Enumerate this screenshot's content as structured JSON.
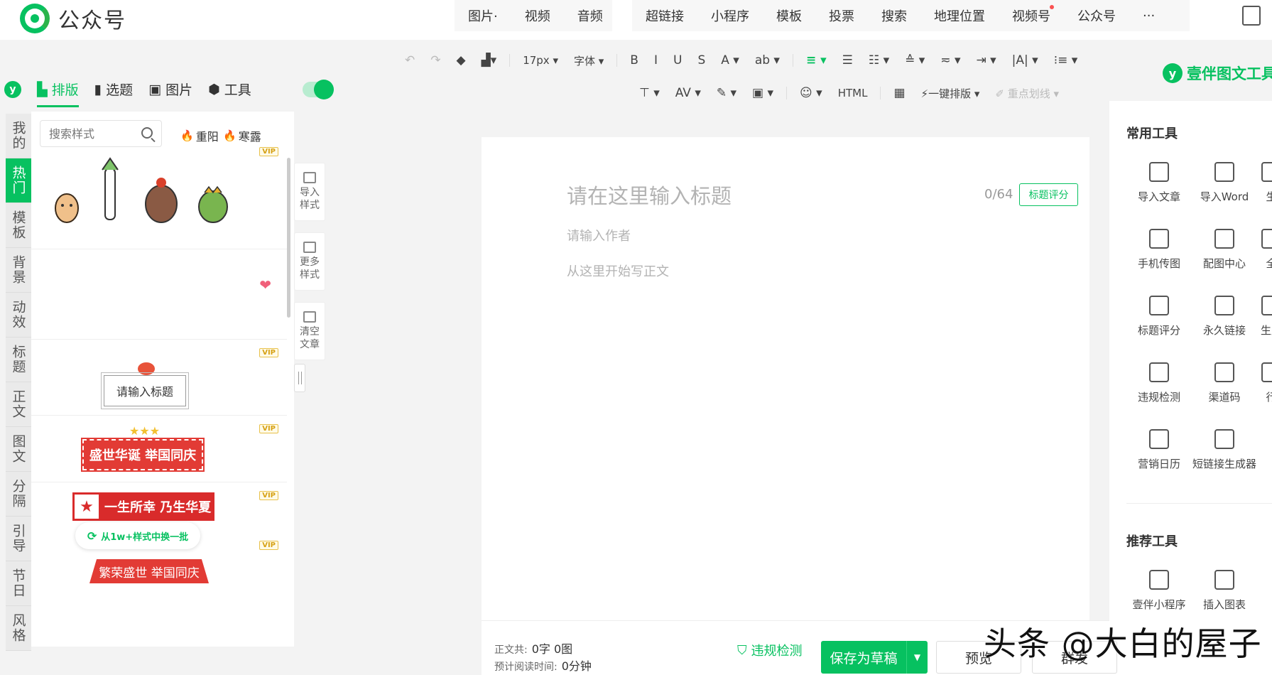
{
  "brand": {
    "name": "公众号"
  },
  "insert_group_1": [
    {
      "label": "图片·",
      "dot": false
    },
    {
      "label": "视频",
      "dot": false
    },
    {
      "label": "音频",
      "dot": false
    }
  ],
  "insert_group_2": [
    {
      "label": "超链接",
      "dot": false
    },
    {
      "label": "小程序",
      "dot": false
    },
    {
      "label": "模板",
      "dot": false
    },
    {
      "label": "投票",
      "dot": false
    },
    {
      "label": "搜索",
      "dot": false
    },
    {
      "label": "地理位置",
      "dot": false
    },
    {
      "label": "视频号",
      "dot": true
    },
    {
      "label": "公众号",
      "dot": false
    },
    {
      "label": "···",
      "dot": false
    }
  ],
  "toolbar_row1": [
    {
      "label": "↶",
      "name": "undo-icon",
      "dim": true
    },
    {
      "label": "↷",
      "name": "redo-icon",
      "dim": true
    },
    {
      "label": "◆",
      "name": "eraser-icon"
    },
    {
      "label": "▟▾",
      "name": "format-painter-icon"
    },
    {
      "label": "17px ▾",
      "name": "font-size-select",
      "sm": true
    },
    {
      "label": "字体 ▾",
      "name": "font-family-select",
      "sm": true
    },
    {
      "label": "B",
      "name": "bold-icon"
    },
    {
      "label": "I",
      "name": "italic-icon"
    },
    {
      "label": "U",
      "name": "underline-icon"
    },
    {
      "label": "S",
      "name": "strikethrough-icon"
    },
    {
      "label": "A ▾",
      "name": "font-color-icon"
    },
    {
      "label": "ab ▾",
      "name": "highlight-icon"
    },
    {
      "label": "≡ ▾",
      "name": "align-icon",
      "active": true
    },
    {
      "label": "☰",
      "name": "indent-icon"
    },
    {
      "label": "☷ ▾",
      "name": "line-height-icon"
    },
    {
      "label": "≙ ▾",
      "name": "paragraph-spacing-icon"
    },
    {
      "label": "≂ ▾",
      "name": "spacing-after-icon"
    },
    {
      "label": "⇥ ▾",
      "name": "indent-list-icon"
    },
    {
      "label": "|A| ▾",
      "name": "letter-spacing-icon"
    },
    {
      "label": "⁝≡ ▾",
      "name": "list-icon"
    }
  ],
  "toolbar_row2": [
    {
      "label": "⊤ ▾",
      "name": "divider-icon"
    },
    {
      "label": "AV ▾",
      "name": "kerning-icon"
    },
    {
      "label": "✎ ▾",
      "name": "magic-pen-icon"
    },
    {
      "label": "▣ ▾",
      "name": "image-icon"
    },
    {
      "label": "☺ ▾",
      "name": "emoji-icon"
    },
    {
      "label": "HTML",
      "name": "html-icon",
      "sm": true
    },
    {
      "label": "▦",
      "name": "toolbox-icon"
    },
    {
      "label": "⚡一键排版 ▾",
      "name": "one-click-layout-button",
      "sm": true
    },
    {
      "label": "✐ 重点划线 ▾",
      "name": "key-underline-button",
      "sm": true,
      "dim": true
    }
  ],
  "left_nav": {
    "logo": "y",
    "tabs": [
      {
        "label": "排版",
        "icon": "▙",
        "active": true
      },
      {
        "label": "选题",
        "icon": "▮",
        "active": false
      },
      {
        "label": "图片",
        "icon": "▣",
        "active": false
      },
      {
        "label": "工具",
        "icon": "⬢",
        "active": false
      }
    ]
  },
  "categories": [
    {
      "label": "我的",
      "active": false
    },
    {
      "label": "热门",
      "active": true
    },
    {
      "label": "模板",
      "active": false
    },
    {
      "label": "背景",
      "active": false
    },
    {
      "label": "动效",
      "active": false
    },
    {
      "label": "标题",
      "active": false
    },
    {
      "label": "正文",
      "active": false
    },
    {
      "label": "图文",
      "active": false
    },
    {
      "label": "分隔",
      "active": false
    },
    {
      "label": "引导",
      "active": false
    },
    {
      "label": "节日",
      "active": false
    },
    {
      "label": "风格",
      "active": false
    }
  ],
  "styles_panel": {
    "search_placeholder": "搜索样式",
    "hot_tags": [
      "重阳",
      "寒露"
    ],
    "vip_badge": "VIP",
    "sample_title": "请输入标题",
    "banner_1": "盛世华诞 举国同庆",
    "banner_2": "一生所幸 乃生华夏",
    "swap_button": "从1w+样式中换一批",
    "banner_3": "繁荣盛世 举国同庆"
  },
  "side_actions": [
    {
      "label": "导入样式",
      "name": "import-style-button"
    },
    {
      "label": "更多样式",
      "name": "more-styles-button"
    },
    {
      "label": "清空文章",
      "name": "clear-article-button"
    }
  ],
  "editor": {
    "title_placeholder": "请在这里输入标题",
    "title_counter": "0/64",
    "title_score_button": "标题评分",
    "author_placeholder": "请输入作者",
    "body_placeholder": "从这里开始写正文"
  },
  "status": {
    "word_count_label": "正文共:",
    "word_count_value": "0字 0图",
    "read_time_label": "预计阅读时间:",
    "read_time_value": "0分钟",
    "check_button": "违规检测",
    "save_button": "保存为草稿",
    "preview_button": "预览",
    "publish_button": "群发"
  },
  "watermark": "头条 @大白的屋子",
  "right_panel": {
    "header": "壹伴图文工具",
    "common_title": "常用工具",
    "common_tools": [
      {
        "label": "导入文章",
        "name": "import-article"
      },
      {
        "label": "导入Word",
        "name": "import-word"
      },
      {
        "label": "生",
        "name": "generate"
      },
      {
        "label": "手机传图",
        "name": "phone-upload"
      },
      {
        "label": "配图中心",
        "name": "image-center"
      },
      {
        "label": "全",
        "name": "full"
      },
      {
        "label": "标题评分",
        "name": "title-score"
      },
      {
        "label": "永久链接",
        "name": "permanent-link"
      },
      {
        "label": "生成",
        "name": "generate-2"
      },
      {
        "label": "违规检测",
        "name": "violation-check"
      },
      {
        "label": "渠道码",
        "name": "channel-code"
      },
      {
        "label": "行",
        "name": "more"
      },
      {
        "label": "营销日历",
        "name": "marketing-calendar"
      },
      {
        "label": "短链接生成器",
        "name": "short-link-generator"
      }
    ],
    "recommend_title": "推荐工具",
    "recommend_tools": [
      {
        "label": "壹伴小程序",
        "name": "yiban-mini-program"
      },
      {
        "label": "插入图表",
        "name": "insert-chart"
      }
    ]
  }
}
